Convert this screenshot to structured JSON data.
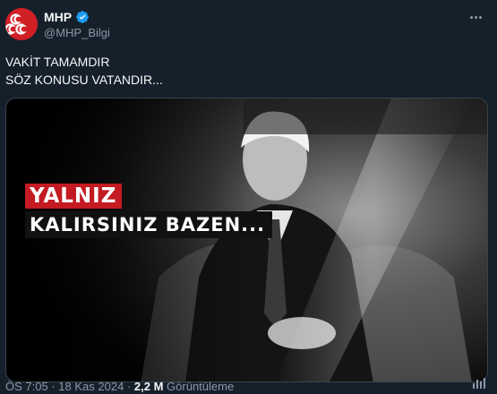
{
  "author": {
    "name": "MHP",
    "handle": "@MHP_Bilgi",
    "verified": true,
    "brand_color": "#d11f26"
  },
  "tweet": {
    "lines": [
      "VAKİT TAMAMDIR",
      "SÖZ KONUSU VATANDIR..."
    ]
  },
  "media": {
    "banner_line1": "YALNIZ",
    "banner_line2": "KALIRSINIZ BAZEN...",
    "banner_accent": "#c41a21"
  },
  "meta": {
    "time": "ÖS 7:05",
    "separator": "·",
    "date": "18 Kas 2024",
    "views_count": "2,2 M",
    "views_label": "Görüntüleme"
  },
  "icons": {
    "more": "more-icon",
    "verified": "verified-badge-icon",
    "analytics": "analytics-icon"
  }
}
